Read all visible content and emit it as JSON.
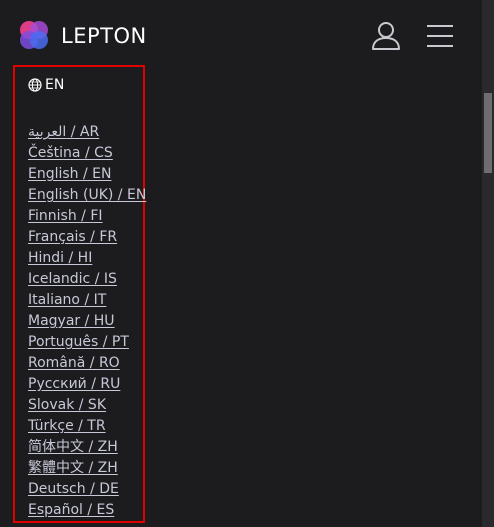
{
  "header": {
    "brand": "LEPTON",
    "logo_icon": "lepton-logo-icon",
    "user_icon": "user-icon",
    "menu_icon": "hamburger-menu-icon"
  },
  "language_menu": {
    "current": "EN",
    "globe_icon": "globe-icon",
    "items": [
      "العربية / AR",
      "Čeština / CS",
      "English / EN",
      "English (UK) / EN",
      "Finnish / FI",
      "Français / FR",
      "Hindi / HI",
      "Icelandic / IS",
      "Italiano / IT",
      "Magyar / HU",
      "Português / PT",
      "Română / RO",
      "Русский / RU",
      "Slovak / SK",
      "Türkçe / TR",
      "简体中文 / ZH",
      "繁體中文 / ZH",
      "Deutsch / DE",
      "Español / ES"
    ]
  },
  "colors": {
    "background": "#1c1c1e",
    "highlight_border": "#e00000",
    "link": "#c7c8d8",
    "text": "#ffffff"
  }
}
